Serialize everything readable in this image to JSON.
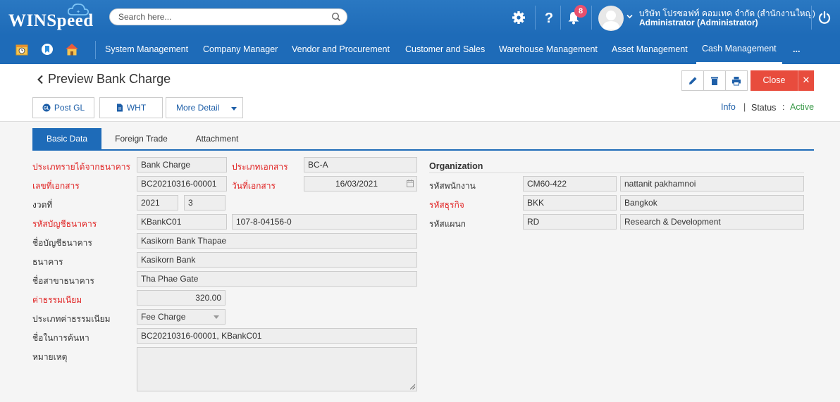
{
  "header": {
    "logo": "WINSpeed",
    "search_placeholder": "Search here...",
    "notification_count": "8",
    "company": "บริษัท โปรซอฟท์ คอมเทค จำกัด (สำนักงานใหญ่)",
    "user": "Administrator (Administrator)"
  },
  "nav": {
    "items": [
      "System Management",
      "Company Manager",
      "Vendor and Procurement",
      "Customer and Sales",
      "Warehouse Management",
      "Asset Management",
      "Cash Management",
      "..."
    ],
    "active": "Cash Management"
  },
  "page": {
    "title": "Preview Bank Charge",
    "close_label": "Close",
    "buttons": {
      "post_gl": "Post GL",
      "wht": "WHT",
      "more_detail": "More Detail"
    },
    "info": "Info",
    "separator": "|",
    "status_label": "Status",
    "status_colon": ":",
    "status_value": "Active"
  },
  "tabs": [
    "Basic Data",
    "Foreign Trade",
    "Attachment"
  ],
  "form": {
    "income_type_label": "ประเภทรายได้จากธนาคาร",
    "income_type": "Bank Charge",
    "doc_type_label": "ประเภทเอกสาร",
    "doc_type": "BC-A",
    "doc_no_label": "เลขที่เอกสาร",
    "doc_no": "BC20210316-00001",
    "doc_date_label": "วันที่เอกสาร",
    "doc_date": "16/03/2021",
    "period_label": "งวดที่",
    "period_year": "2021",
    "period_no": "3",
    "bank_account_label": "รหัสบัญชีธนาคาร",
    "bank_account_code": "KBankC01",
    "bank_account_no": "107-8-04156-0",
    "account_name_label": "ชื่อบัญชีธนาคาร",
    "account_name": "Kasikorn Bank Thapae",
    "bank_label": "ธนาคาร",
    "bank": "Kasikorn Bank",
    "branch_label": "ชื่อสาขาธนาคาร",
    "branch": "Tha Phae Gate",
    "fee_label": "ค่าธรรมเนียม",
    "fee": "320.00",
    "fee_type_label": "ประเภทค่าธรรมเนียม",
    "fee_type": "Fee Charge",
    "search_name_label": "ชื่อในการค้นหา",
    "search_name": "BC20210316-00001, KBankC01",
    "remark_label": "หมายเหตุ",
    "remark": ""
  },
  "organization": {
    "title": "Organization",
    "employee_label": "รหัสพนักงาน",
    "employee_code": "CM60-422",
    "employee_name": "nattanit pakhamnoi",
    "business_label": "รหัสธุรกิจ",
    "business_code": "BKK",
    "business_name": "Bangkok",
    "department_label": "รหัสแผนก",
    "department_code": "RD",
    "department_name": "Research & Development"
  },
  "colors": {
    "brand": "#1e6bb8",
    "danger": "#e84c3d",
    "required": "#e02020",
    "status": "#3c9a4a"
  }
}
